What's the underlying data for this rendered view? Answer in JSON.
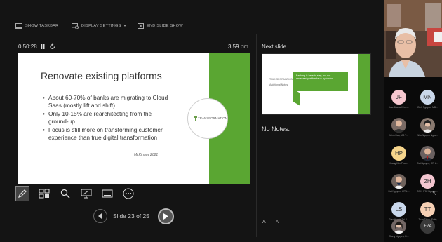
{
  "toolbar": {
    "show_taskbar": "SHOW TASKBAR",
    "display_settings": "DISPLAY SETTINGS",
    "display_settings_caret": "▾",
    "end_slide_show": "END SLIDE SHOW"
  },
  "status": {
    "elapsed": "0:50:28",
    "clock": "3:59 pm"
  },
  "current_slide": {
    "title": "Renovate existing platforms",
    "bullets": [
      "About 60-70% of banks are migrating to Cloud Saas (mostly lift and shift)",
      "Only 10-15% are rearchitecting from the ground-up",
      "Focus is still more on transforming customer experience than true digital transformation"
    ],
    "source": "McKinsey 2021",
    "logo_text": "TRANSFORMATION",
    "accent_color": "#5aa632"
  },
  "navigation": {
    "counter": "Slide 23 of 25"
  },
  "next_slide": {
    "label": "Next slide",
    "thumb_text": "Banking is here to stay, but not necessarily at banks or by banks",
    "thumb_logo": "TRANSFORMATION",
    "thumb_subtitle": "Additional Notes"
  },
  "notes": {
    "text": "No Notes."
  },
  "font_controls": {
    "increase": "A",
    "decrease": "A"
  },
  "tools": [
    {
      "name": "pen-icon"
    },
    {
      "name": "slides-grid-icon"
    },
    {
      "name": "zoom-icon"
    },
    {
      "name": "pointer-icon"
    },
    {
      "name": "subtitles-icon"
    },
    {
      "name": "more-icon"
    }
  ],
  "participants": [
    {
      "initials": "JF",
      "name": "Jose Manuel Fern...",
      "color": "#f6c7cf",
      "type": "initials"
    },
    {
      "initials": "MN",
      "name": "Dinh Nguyen, MB...",
      "color": "#c9d7ea",
      "type": "initials"
    },
    {
      "initials": "",
      "name": "Minh Dao, MB T...",
      "color": "#7a6a64",
      "type": "photo"
    },
    {
      "initials": "",
      "name": "Nhu Nguyen Ngoc...",
      "color": "#8a7a70",
      "type": "photo"
    },
    {
      "initials": "HP",
      "name": "Hoang Kim Phuo...",
      "color": "#f6d58c",
      "type": "initials"
    },
    {
      "initials": "",
      "name": "Dat Nguyen, ICT L...",
      "color": "#6a6060",
      "type": "photo"
    },
    {
      "initials": "",
      "name": "Dat Nguyen, ICT L...",
      "color": "#6f625c",
      "type": "photo"
    },
    {
      "initials": "2H",
      "name": "DSHHT02 Nguyen...",
      "color": "#f3c6d0",
      "type": "initials"
    },
    {
      "initials": "LS",
      "name": "Giao Huynh Thi D...",
      "color": "#c9d8ec",
      "type": "initials"
    },
    {
      "initials": "TT",
      "name": "Tuan Thieu (Fabi)",
      "color": "#f6d0b4",
      "type": "initials"
    },
    {
      "initials": "",
      "name": "Giang Nguyen, D...",
      "color": "#726664",
      "type": "photo"
    },
    {
      "initials": "+24",
      "name": "",
      "color": "#3a3a3a",
      "type": "more"
    }
  ]
}
